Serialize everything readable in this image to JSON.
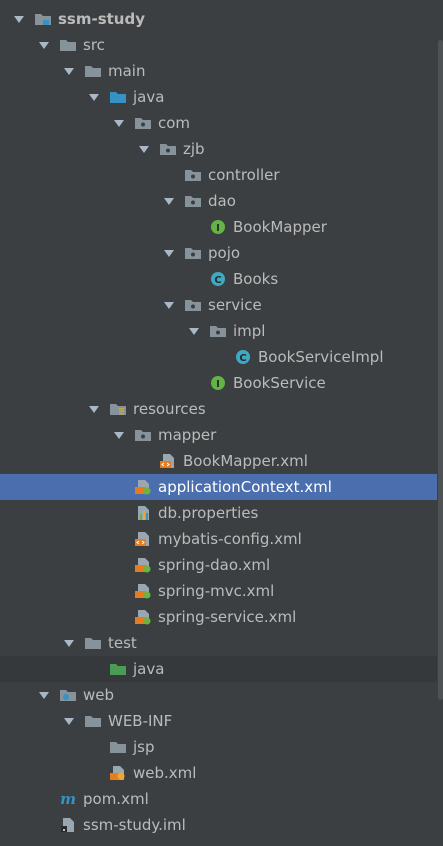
{
  "tree": {
    "items": [
      {
        "label": "ssm-study",
        "depth": 0,
        "expanded": true,
        "icon": "module-folder-icon",
        "bold": true
      },
      {
        "label": "src",
        "depth": 1,
        "expanded": true,
        "icon": "folder-icon"
      },
      {
        "label": "main",
        "depth": 2,
        "expanded": true,
        "icon": "folder-icon"
      },
      {
        "label": "java",
        "depth": 3,
        "expanded": true,
        "icon": "source-root-folder-icon"
      },
      {
        "label": "com",
        "depth": 4,
        "expanded": true,
        "icon": "package-icon"
      },
      {
        "label": "zjb",
        "depth": 5,
        "expanded": true,
        "icon": "package-icon"
      },
      {
        "label": "controller",
        "depth": 6,
        "icon": "package-icon"
      },
      {
        "label": "dao",
        "depth": 6,
        "expanded": true,
        "icon": "package-icon"
      },
      {
        "label": "BookMapper",
        "depth": 7,
        "icon": "interface-icon"
      },
      {
        "label": "pojo",
        "depth": 6,
        "expanded": true,
        "icon": "package-icon"
      },
      {
        "label": "Books",
        "depth": 7,
        "icon": "class-icon"
      },
      {
        "label": "service",
        "depth": 6,
        "expanded": true,
        "icon": "package-icon"
      },
      {
        "label": "impl",
        "depth": 7,
        "expanded": true,
        "icon": "package-icon"
      },
      {
        "label": "BookServiceImpl",
        "depth": 8,
        "icon": "class-icon"
      },
      {
        "label": "BookService",
        "depth": 7,
        "icon": "interface-icon"
      },
      {
        "label": "resources",
        "depth": 3,
        "expanded": true,
        "icon": "resources-folder-icon"
      },
      {
        "label": "mapper",
        "depth": 4,
        "expanded": true,
        "icon": "package-icon"
      },
      {
        "label": "BookMapper.xml",
        "depth": 5,
        "icon": "xml-file-icon"
      },
      {
        "label": "applicationContext.xml",
        "depth": 4,
        "icon": "spring-xml-file-icon",
        "selected": true
      },
      {
        "label": "db.properties",
        "depth": 4,
        "icon": "properties-file-icon"
      },
      {
        "label": "mybatis-config.xml",
        "depth": 4,
        "icon": "xml-file-icon"
      },
      {
        "label": "spring-dao.xml",
        "depth": 4,
        "icon": "spring-xml-file-icon"
      },
      {
        "label": "spring-mvc.xml",
        "depth": 4,
        "icon": "spring-xml-file-icon"
      },
      {
        "label": "spring-service.xml",
        "depth": 4,
        "icon": "spring-xml-file-icon"
      },
      {
        "label": "test",
        "depth": 2,
        "expanded": true,
        "icon": "folder-icon"
      },
      {
        "label": "java",
        "depth": 3,
        "icon": "test-source-root-folder-icon",
        "testbg": true
      },
      {
        "label": "web",
        "depth": 1,
        "expanded": true,
        "icon": "web-folder-icon"
      },
      {
        "label": "WEB-INF",
        "depth": 2,
        "expanded": true,
        "icon": "folder-icon"
      },
      {
        "label": "jsp",
        "depth": 3,
        "icon": "folder-icon"
      },
      {
        "label": "web.xml",
        "depth": 3,
        "icon": "web-xml-file-icon"
      },
      {
        "label": "pom.xml",
        "depth": 1,
        "icon": "maven-icon"
      },
      {
        "label": "ssm-study.iml",
        "depth": 1,
        "icon": "iml-file-icon"
      }
    ]
  },
  "colors": {
    "background": "#3c3f41",
    "selection": "#4b6eaf",
    "text": "#bbbbbb",
    "folder": "#87939a",
    "source_root": "#3592c4",
    "test_root": "#499c54",
    "interface": "#62b543",
    "class": "#3fa9c4",
    "xml": "#e57c1f"
  }
}
